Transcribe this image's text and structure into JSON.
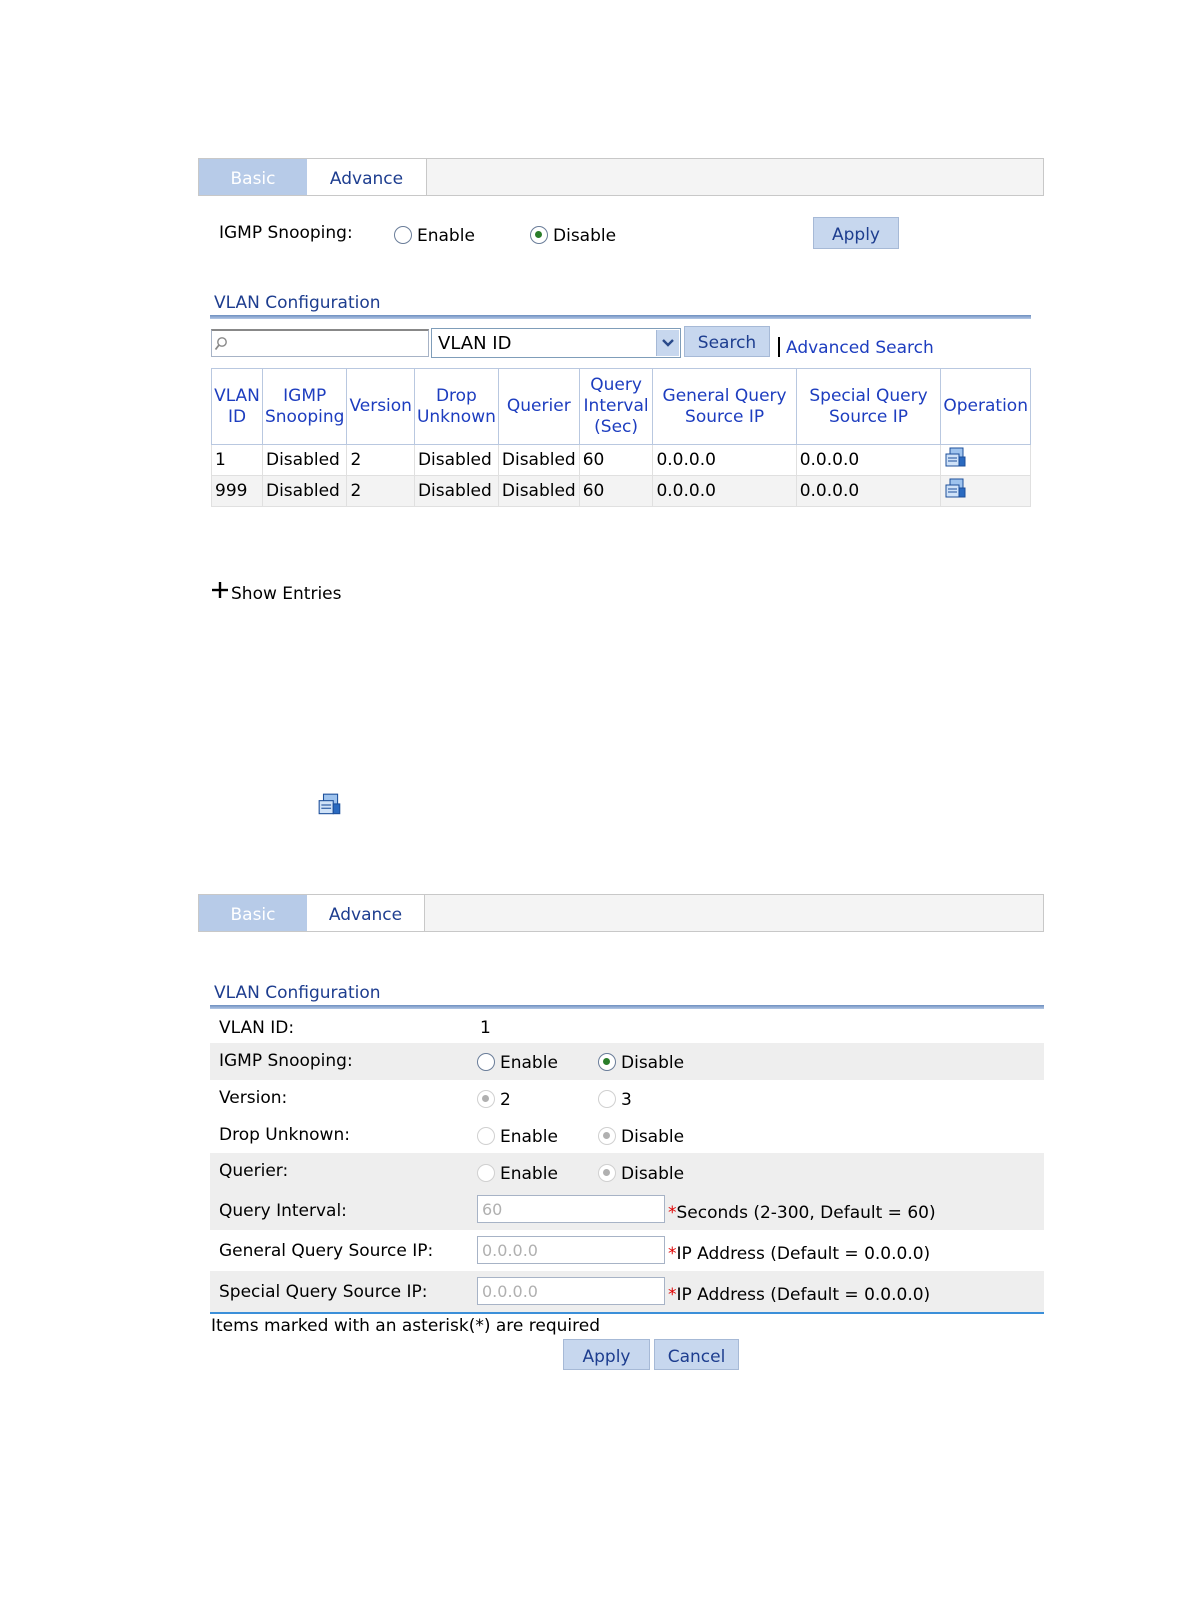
{
  "top": {
    "tabs": {
      "basic": "Basic",
      "advance": "Advance"
    },
    "igmp_label": "IGMP Snooping:",
    "enable": "Enable",
    "disable": "Disable",
    "selected": "Disable",
    "apply": "Apply",
    "section_title": "VLAN Configuration",
    "search": {
      "placeholder": "",
      "select_value": "VLAN ID",
      "button": "Search",
      "advanced": "Advanced Search"
    },
    "table": {
      "headers": {
        "vlan_id": [
          "VLAN",
          "ID"
        ],
        "igmp_snooping": [
          "IGMP",
          "Snooping"
        ],
        "version": [
          "Version"
        ],
        "drop_unknown": [
          "Drop",
          "Unknown"
        ],
        "querier": [
          "Querier"
        ],
        "query_interval": [
          "Query",
          "Interval",
          "(Sec)"
        ],
        "general_query": [
          "General Query",
          "Source IP"
        ],
        "special_query": [
          "Special Query",
          "Source IP"
        ],
        "operation": [
          "Operation"
        ]
      },
      "rows": [
        {
          "vlan": "1",
          "snooping": "Disabled",
          "version": "2",
          "drop": "Disabled",
          "querier": "Disabled",
          "interval": "60",
          "general": "0.0.0.0",
          "special": "0.0.0.0"
        },
        {
          "vlan": "999",
          "snooping": "Disabled",
          "version": "2",
          "drop": "Disabled",
          "querier": "Disabled",
          "interval": "60",
          "general": "0.0.0.0",
          "special": "0.0.0.0"
        }
      ]
    },
    "show_entries": "Show Entries"
  },
  "bottom": {
    "tabs": {
      "basic": "Basic",
      "advance": "Advance"
    },
    "section_title": "VLAN Configuration",
    "vlan_id_label": "VLAN ID:",
    "vlan_id_value": "1",
    "igmp_label": "IGMP Snooping:",
    "igmp_enable": "Enable",
    "igmp_disable": "Disable",
    "version_label": "Version:",
    "version_2": "2",
    "version_3": "3",
    "drop_label": "Drop Unknown:",
    "drop_enable": "Enable",
    "drop_disable": "Disable",
    "querier_label": "Querier:",
    "querier_enable": "Enable",
    "querier_disable": "Disable",
    "interval_label": "Query Interval:",
    "interval_value": "60",
    "interval_hint": "Seconds (2-300, Default = 60)",
    "general_label": "General Query Source IP:",
    "general_value": "0.0.0.0",
    "general_hint": "IP Address (Default = 0.0.0.0)",
    "special_label": "Special Query Source IP:",
    "special_value": "0.0.0.0",
    "special_hint": "IP Address (Default = 0.0.0.0)",
    "asterisk": "*",
    "required_note": "Items marked with an asterisk(*) are required",
    "apply": "Apply",
    "cancel": "Cancel"
  },
  "icons": {
    "operation": "operation-config-icon",
    "search": "search-icon",
    "dropdown": "chevron-down-icon",
    "expand": "plus-icon"
  },
  "colors": {
    "accent": "#1d3dbf",
    "tab_active": "#b7cbe8",
    "button": "#c7d7ee",
    "required": "#e00000"
  }
}
